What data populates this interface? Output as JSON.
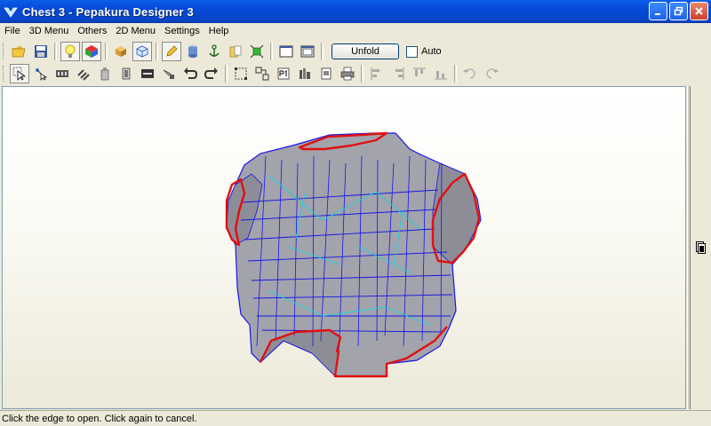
{
  "window": {
    "title": "Chest 3 - Pepakura Designer 3"
  },
  "menu": [
    "File",
    "3D Menu",
    "Others",
    "2D Menu",
    "Settings",
    "Help"
  ],
  "toolbar1": {
    "unfold_label": "Unfold",
    "auto_label": "Auto",
    "auto_checked": false
  },
  "status": {
    "text": "Click the edge to open. Click again to cancel."
  },
  "colors": {
    "title_bar": "#0a5ee8",
    "mesh_face": "#a3a3ac",
    "mesh_edge": "#1616e6",
    "fold_line": "#11d8e0",
    "cut_edge": "#e01010"
  }
}
